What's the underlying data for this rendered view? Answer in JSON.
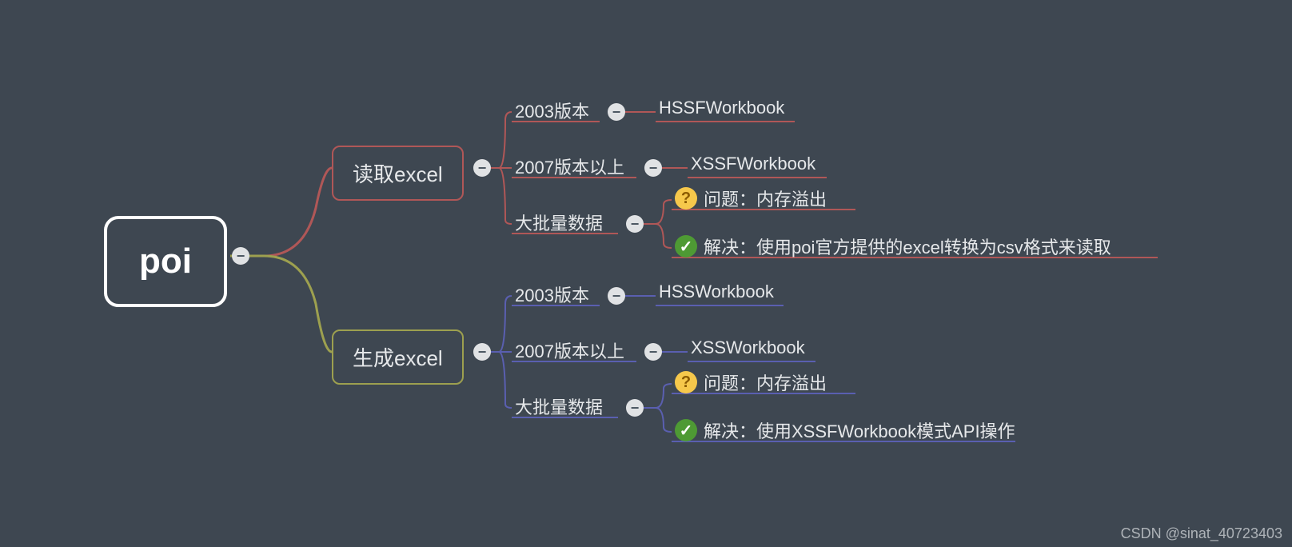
{
  "root": {
    "label": "poi"
  },
  "branch1": {
    "label": "读取excel",
    "color": "#b05757",
    "items": [
      {
        "left": "2003版本",
        "right": "HSSFWorkbook"
      },
      {
        "left": "2007版本以上",
        "right": "XSSFWorkbook"
      },
      {
        "left": "大批量数据",
        "children": [
          {
            "icon": "question",
            "text": "问题：内存溢出"
          },
          {
            "icon": "check",
            "text": "解决：使用poi官方提供的excel转换为csv格式来读取"
          }
        ]
      }
    ]
  },
  "branch2": {
    "label": "生成excel",
    "color": "#5a5fb0",
    "items": [
      {
        "left": "2003版本",
        "right": "HSSWorkbook"
      },
      {
        "left": "2007版本以上",
        "right": "XSSWorkbook"
      },
      {
        "left": "大批量数据",
        "children": [
          {
            "icon": "question",
            "text": "问题：内存溢出"
          },
          {
            "icon": "check",
            "text": "解决：使用XSSFWorkbook模式API操作"
          }
        ]
      }
    ]
  },
  "watermark": "CSDN @sinat_40723403"
}
